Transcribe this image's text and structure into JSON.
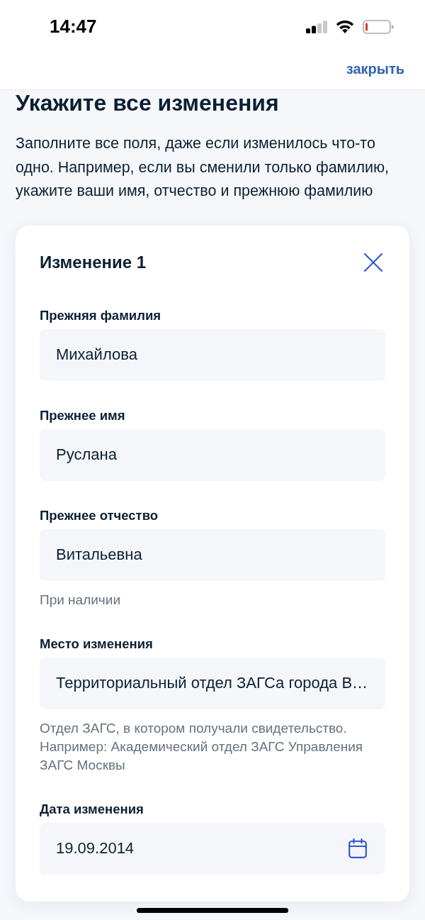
{
  "status_bar": {
    "time": "14:47"
  },
  "nav": {
    "close_link": "закрыть"
  },
  "heading": "Укажите все изменения",
  "description": "Заполните все поля, даже если изменилось что-то одно. Например, если вы сменили только фамилию, укажите ваши имя, отчество и прежнюю фамилию",
  "change_card": {
    "title": "Изменение 1",
    "fields": [
      {
        "kind": "text",
        "label": "Прежняя фамилия",
        "value": "Михайлова"
      },
      {
        "kind": "text",
        "label": "Прежнее имя",
        "value": "Руслана"
      },
      {
        "kind": "text",
        "label": "Прежнее отчество",
        "value": "Витальевна",
        "hint": "При наличии"
      },
      {
        "kind": "text",
        "label": "Место изменения",
        "value": "Территориальный отдел ЗАГСа города В…",
        "hint": "Отдел ЗАГС, в котором получали свидетельство. Например: Академический отдел ЗАГС Управления ЗАГС Москвы"
      },
      {
        "kind": "date",
        "label": "Дата изменения",
        "value": "19.09.2014"
      }
    ]
  }
}
